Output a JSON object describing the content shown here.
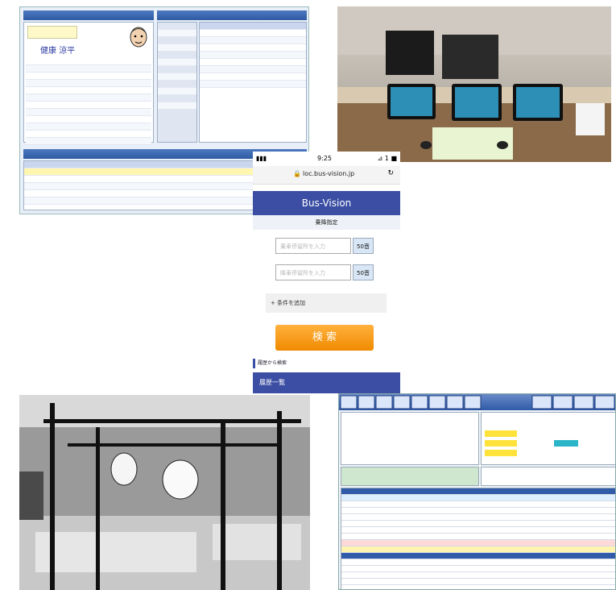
{
  "phone": {
    "status_time": "9:25",
    "status_right": "⊿ 1 ■",
    "url": "loc.bus-vision.jp",
    "brand": "Bus-Vision",
    "subtitle": "乗降指定",
    "board_placeholder": "乗車停留所を入力",
    "alight_placeholder": "降車停留所を入力",
    "kana_button": "50音",
    "add_condition": "+ 条件を追加",
    "search_button": "検 索",
    "history_heading": "履歴から検索",
    "history_list": "履歴一覧"
  },
  "patient_app": {
    "patient_name": "健康 涼平",
    "left_rows": [
      "",
      "",
      "",
      "",
      "",
      "",
      "",
      "",
      "",
      "",
      "",
      "",
      "",
      "",
      ""
    ],
    "list_rows": [
      "",
      "",
      "",
      "",
      "",
      "",
      "",
      "",
      "",
      "",
      "",
      "",
      ""
    ],
    "bottom_rows": [
      "",
      "",
      "",
      "",
      "",
      "",
      ""
    ]
  },
  "accounting_app": {
    "grid_rows": [
      "",
      "",
      "",
      "",
      "",
      "",
      "",
      "",
      "",
      "",
      "",
      "",
      "",
      "",
      "",
      "",
      ""
    ]
  },
  "colors": {
    "brand_blue": "#3b4ea3",
    "search_orange": "#f08a00",
    "app_blue": "#2f5ba8"
  }
}
